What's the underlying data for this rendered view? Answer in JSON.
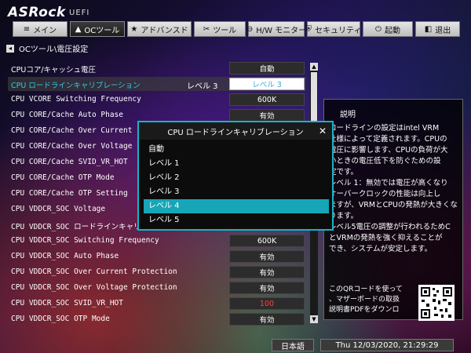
{
  "brand": {
    "name": "ASRock",
    "sub": "UEFI"
  },
  "nav": {
    "tabs": [
      {
        "label": "メイン",
        "icon": "≡"
      },
      {
        "label": "OCツール",
        "icon": "▲"
      },
      {
        "label": "アドバンスド",
        "icon": "★"
      },
      {
        "label": "ツール",
        "icon": "✂"
      },
      {
        "label": "H/W モニター",
        "icon": "⊖"
      },
      {
        "label": "セキュリティ",
        "icon": "⛨"
      },
      {
        "label": "起動",
        "icon": "⏻"
      },
      {
        "label": "退出",
        "icon": "◧"
      }
    ]
  },
  "breadcrumb": {
    "back": "◂",
    "text": "OCツール\\電圧設定"
  },
  "settings": [
    {
      "label": "CPUコア/キャッシュ電圧",
      "current": "",
      "value": "自動"
    },
    {
      "label": "CPU ロードラインキャリブレーション",
      "current": "レベル 3",
      "value": "レベル 3"
    },
    {
      "label": "CPU VCORE Switching Frequency",
      "current": "",
      "value": "600K"
    },
    {
      "label": "CPU CORE/Cache Auto Phase",
      "current": "",
      "value": "有効"
    },
    {
      "label": "CPU CORE/Cache Over Current Protection",
      "current": "",
      "value": ""
    },
    {
      "label": "CPU CORE/Cache Over Voltage Protection",
      "current": "",
      "value": ""
    },
    {
      "label": "CPU CORE/Cache SVID_VR_HOT",
      "current": "",
      "value": ""
    },
    {
      "label": "CPU CORE/Cache OTP Mode",
      "current": "",
      "value": ""
    },
    {
      "label": "CPU CORE/Cache OTP Setting",
      "current": "",
      "value": ""
    },
    {
      "label": "CPU VDDCR_SOC Voltage",
      "current": "",
      "value": ""
    },
    {
      "label": "CPU VDDCR_SOC ロードラインキャリブ",
      "current": "",
      "value": ""
    },
    {
      "label": "CPU VDDCR_SOC Switching Frequency",
      "current": "",
      "value": "600K"
    },
    {
      "label": "CPU VDDCR_SOC Auto Phase",
      "current": "",
      "value": "有効"
    },
    {
      "label": "CPU VDDCR_SOC Over Current Protection",
      "current": "",
      "value": "有効"
    },
    {
      "label": "CPU VDDCR_SOC Over Voltage Protection",
      "current": "",
      "value": "有効"
    },
    {
      "label": "CPU VDDCR_SOC SVID_VR_HOT",
      "current": "",
      "value": "100"
    },
    {
      "label": "CPU VDDCR_SOC OTP Mode",
      "current": "",
      "value": "有効"
    }
  ],
  "scrollbar": {
    "up": "▲",
    "down": "▼"
  },
  "description": {
    "title": "説明",
    "text": "ロードラインの設定はintel VRM\n仕様によって定義されます。CPUの\n電圧に影響します、CPUの負荷が大\nいときの電圧低下を防ぐための設\n定です。\nレベル 1：無効では電圧が高くなり\nオーバークロックの性能は向上し\nますが、VRMとCPUの発熱が大きくな\nります。\nレベル5電圧の調整が行われるためC\nとVRMの発熱を強く抑えることが\nでき、システムが安定します。",
    "qr_text": "このQRコードを使って\n、マザーボードの取扱\n説明書PDFをダウンロ"
  },
  "footer": {
    "language": "日本語",
    "datetime": "Thu 12/03/2020, 21:29:29"
  },
  "dialog": {
    "title": "CPU ロードラインキャリブレーション",
    "close": "✕",
    "options": [
      "自動",
      "レベル 1",
      "レベル 2",
      "レベル 3",
      "レベル 4",
      "レベル 5"
    ],
    "selected_index": 4
  },
  "colors": {
    "accent": "#16b3c8",
    "selected_text": "#34c6e6",
    "warning": "#ff4040"
  }
}
